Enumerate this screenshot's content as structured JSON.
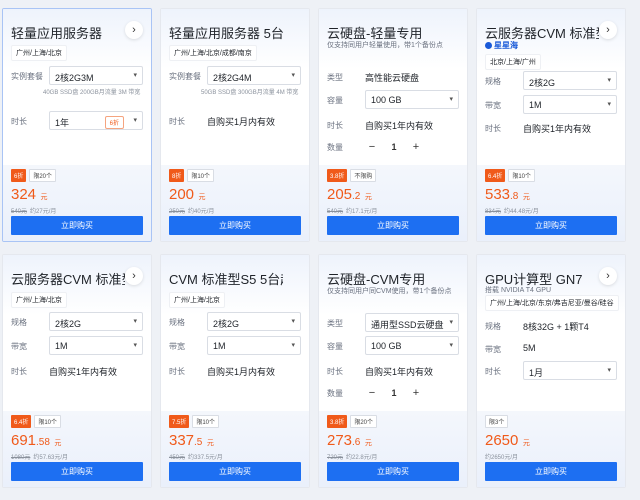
{
  "cards": [
    {
      "title": "轻量应用服务器",
      "region": "广州/上海/北京",
      "plan_label": "实例套餐",
      "plan_value": "2核2G3M",
      "plan_note": "40GB SSD盘 200GB月流量 3M 带宽",
      "duration_label": "时长",
      "duration_value": "1年",
      "duration_discount": "6折",
      "tags": {
        "discount": "6折",
        "limit": "限20个"
      },
      "price": "324",
      "price_dec": "",
      "price_unit": "元",
      "orig_price": "540元",
      "monthly": "约27元/月",
      "buy": "立即购买"
    },
    {
      "title": "轻量应用服务器 5台起",
      "region": "广州/上海/北京/成都/南京",
      "plan_label": "实例套餐",
      "plan_value": "2核2G4M",
      "plan_note": "50GB SSD盘 300GB月流量 4M 带宽",
      "duration_label": "时长",
      "duration_value": "自购买1月内有效",
      "tags": {
        "discount": "8折",
        "limit": "限10个"
      },
      "price": "200",
      "price_dec": "",
      "price_unit": "元",
      "orig_price": "250元",
      "monthly": "约40元/月",
      "buy": "立即购买"
    },
    {
      "title": "云硬盘-轻量专用",
      "subtitle": "仅支持同用户轻量使用，带1个备份点",
      "type_label": "类型",
      "type_value": "高性能云硬盘",
      "cap_label": "容量",
      "cap_value": "100 GB",
      "duration_label": "时长",
      "duration_value": "自购买1年内有效",
      "qty_label": "数量",
      "qty_minus": "−",
      "qty_value": "1",
      "qty_plus": "+",
      "tags": {
        "discount": "3.8折",
        "limit": "不限购"
      },
      "price": "205",
      "price_dec": ".2",
      "price_unit": "元",
      "orig_price": "540元",
      "monthly": "约17.1元/月",
      "buy": "立即购买"
    },
    {
      "title": "云服务器CVM 标准型SA2",
      "brand": "星星海",
      "region": "北京/上海/广州",
      "spec_label": "规格",
      "spec_value": "2核2G",
      "bw_label": "带宽",
      "bw_value": "1M",
      "duration_label": "时长",
      "duration_value": "自购买1年内有效",
      "tags": {
        "discount": "6.4折",
        "limit": "限10个"
      },
      "price": "533",
      "price_dec": ".8",
      "price_unit": "元",
      "orig_price": "834元",
      "monthly": "约44.48元/月",
      "buy": "立即购买"
    },
    {
      "title": "云服务器CVM 标准型S5",
      "region": "广州/上海/北京",
      "spec_label": "规格",
      "spec_value": "2核2G",
      "bw_label": "带宽",
      "bw_value": "1M",
      "duration_label": "时长",
      "duration_value": "自购买1年内有效",
      "tags": {
        "discount": "6.4折",
        "limit": "限10个"
      },
      "price": "691",
      "price_dec": ".58",
      "price_unit": "元",
      "orig_price": "1080元",
      "monthly": "约57.63元/月",
      "buy": "立即购买"
    },
    {
      "title": "CVM 标准型S5 5台起",
      "region": "广州/上海/北京",
      "spec_label": "规格",
      "spec_value": "2核2G",
      "bw_label": "带宽",
      "bw_value": "1M",
      "duration_label": "时长",
      "duration_value": "自购买1月内有效",
      "tags": {
        "discount": "7.5折",
        "limit": "限10个"
      },
      "price": "337",
      "price_dec": ".5",
      "price_unit": "元",
      "orig_price": "450元",
      "monthly": "约337.5元/月",
      "buy": "立即购买"
    },
    {
      "title": "云硬盘-CVM专用",
      "subtitle": "仅支持同用户同CVM使用，带1个备份点",
      "type_label": "类型",
      "type_value": "通用型SSD云硬盘",
      "cap_label": "容量",
      "cap_value": "100 GB",
      "duration_label": "时长",
      "duration_value": "自购买1年内有效",
      "qty_label": "数量",
      "qty_minus": "−",
      "qty_value": "1",
      "qty_plus": "+",
      "tags": {
        "discount": "3.8折",
        "limit": "限20个"
      },
      "price": "273",
      "price_dec": ".6",
      "price_unit": "元",
      "orig_price": "720元",
      "monthly": "约22.8元/月",
      "buy": "立即购买"
    },
    {
      "title": "GPU计算型 GN7",
      "desc": "搭载 NVIDIA T4 GPU",
      "region": "广州/上海/北京/东京/弗吉尼亚/曼谷/硅谷",
      "spec_label": "规格",
      "spec_value": "8核32G + 1颗T4",
      "bw_label": "带宽",
      "bw_value": "5M",
      "duration_label": "时长",
      "duration_value": "1月",
      "tags": {
        "limit": "限3个"
      },
      "price": "2650",
      "price_dec": "",
      "price_unit": "元",
      "monthly": "约2650元/月",
      "buy": "立即购买"
    }
  ]
}
